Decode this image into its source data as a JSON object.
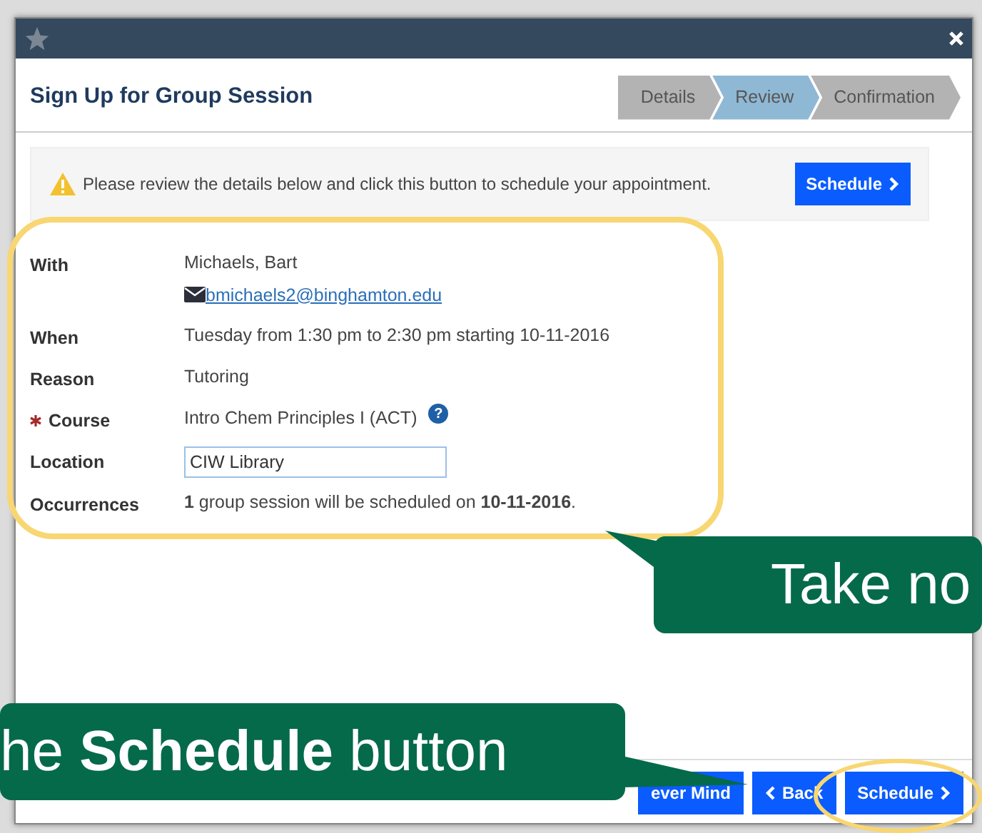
{
  "dialog": {
    "title": "Sign Up for Group Session",
    "steps": [
      {
        "label": "Details",
        "selected": false
      },
      {
        "label": "Review",
        "selected": true
      },
      {
        "label": "Confirmation",
        "selected": false
      }
    ],
    "notice": {
      "text": "Please review the details below and click this button to schedule your appointment.",
      "button": "Schedule"
    },
    "details": [
      {
        "kind": "contact",
        "label": "With",
        "required": false,
        "value": "Michaels, Bart",
        "email": "bmichaels2@binghamton.edu"
      },
      {
        "kind": "text",
        "label": "When",
        "required": false,
        "value": "Tuesday from 1:30 pm to 2:30 pm starting 10-11-2016"
      },
      {
        "kind": "text",
        "label": "Reason",
        "required": false,
        "value": "Tutoring"
      },
      {
        "kind": "text",
        "label": "Course",
        "required": true,
        "help": "?",
        "value": "Intro Chem Principles I (ACT)"
      },
      {
        "kind": "input",
        "label": "Location",
        "required": false,
        "value": "CIW Library"
      },
      {
        "kind": "rich",
        "label": "Occurrences",
        "required": false,
        "value": "**1** group session will be scheduled on **10-11-2016**."
      }
    ],
    "footer_buttons": [
      {
        "label": "ever Mind"
      },
      {
        "label": "Back"
      },
      {
        "label": "Schedule"
      }
    ]
  },
  "callouts": [
    {
      "text": "Take no"
    },
    {
      "text": "he **Schedule** button"
    }
  ]
}
